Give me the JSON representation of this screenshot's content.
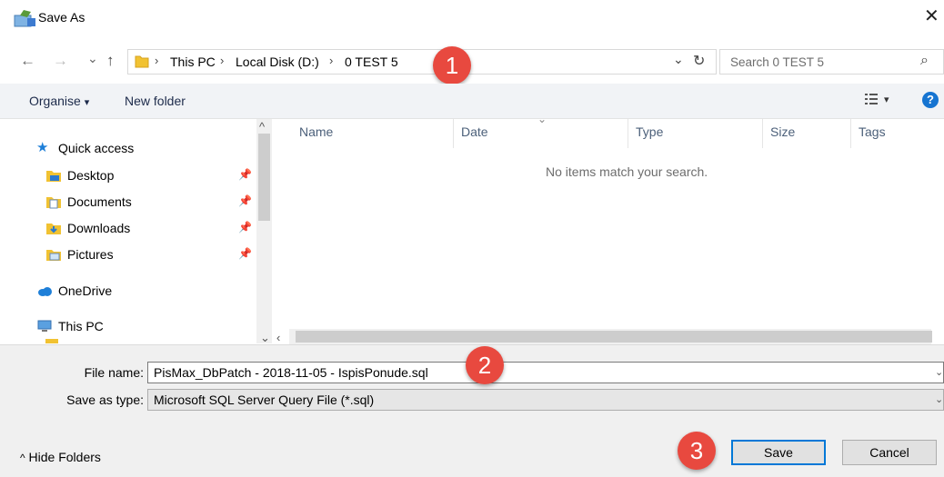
{
  "window": {
    "title": "Save As",
    "close_glyph": "✕"
  },
  "nav": {
    "back_glyph": "←",
    "forward_glyph": "→",
    "recent_glyph": "⌄",
    "up_glyph": "↑",
    "breadcrumb": [
      "This PC",
      "Local Disk (D:)",
      "0 TEST 5"
    ],
    "separator": "›",
    "dropdown_glyph": "⌄",
    "refresh_glyph": "↻",
    "search_placeholder": "Search 0 TEST 5",
    "search_glyph": "⌕"
  },
  "toolbar": {
    "organise": "Organise",
    "organise_caret": "▾",
    "new_folder": "New folder",
    "view_caret": "▾",
    "help": "?"
  },
  "sidebar": {
    "quick_access": "Quick access",
    "items": [
      {
        "label": "Desktop",
        "icon": "desktop-folder-icon"
      },
      {
        "label": "Documents",
        "icon": "documents-folder-icon"
      },
      {
        "label": "Downloads",
        "icon": "downloads-folder-icon"
      },
      {
        "label": "Pictures",
        "icon": "pictures-folder-icon"
      }
    ],
    "pin_glyph": "📌",
    "onedrive": "OneDrive",
    "this_pc": "This PC",
    "scroll_up": "^",
    "scroll_down": "⌄"
  },
  "file_list": {
    "columns": [
      "Name",
      "Date",
      "Type",
      "Size",
      "Tags"
    ],
    "sort_glyph": "⌄",
    "empty_message": "No items match your search.",
    "scroll_left": "‹"
  },
  "form": {
    "file_name_label": "File name:",
    "file_name_value": "PisMax_DbPatch - 2018-11-05 - IspisPonude.sql",
    "save_type_label": "Save as type:",
    "save_type_value": "Microsoft SQL Server Query File (*.sql)",
    "dropdown_glyph": "⌄"
  },
  "footer": {
    "hide_folders": "Hide Folders",
    "hide_caret": "^",
    "save": "Save",
    "cancel": "Cancel"
  },
  "markers": [
    "1",
    "2",
    "3"
  ],
  "colors": {
    "marker": "#e8493f",
    "accent": "#0078d7",
    "help": "#1674d1",
    "folder": "#f1c232"
  }
}
